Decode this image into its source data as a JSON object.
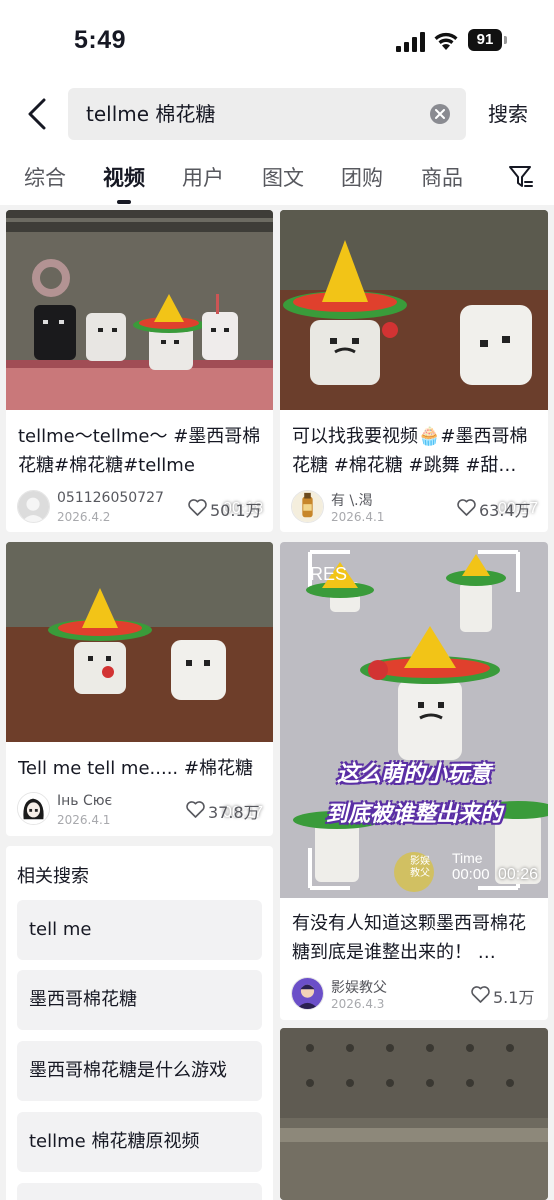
{
  "status_bar": {
    "time": "5:49",
    "battery": "91"
  },
  "search": {
    "query": "tellme 棉花糖",
    "button_label": "搜索"
  },
  "tabs": [
    {
      "label": "综合",
      "active": false
    },
    {
      "label": "视频",
      "active": true
    },
    {
      "label": "用户",
      "active": false
    },
    {
      "label": "图文",
      "active": false
    },
    {
      "label": "团购",
      "active": false
    },
    {
      "label": "商品",
      "active": false
    }
  ],
  "videos": [
    {
      "title": "tellme～tellme～ #墨西哥棉花糖#棉花糖#tellme",
      "duration": "00:18",
      "author": "051126050727",
      "date": "2026.4.2",
      "likes": "50.1万"
    },
    {
      "title": "可以找我要视频🧁#墨西哥棉花糖 #棉花糖 #跳舞 #甜…",
      "duration": "00:17",
      "author": "有 \\.渴",
      "date": "2026.4.1",
      "likes": "63.4万"
    },
    {
      "title": "Tell me tell me..... #棉花糖",
      "duration": "00:17",
      "author": "Інь Сює",
      "date": "2026.4.1",
      "likes": "37.8万"
    },
    {
      "title": "有没有人知道这颗墨西哥棉花糖到底是谁整出来的！ …",
      "duration": "00:26",
      "author": "影娱教父",
      "date": "2026.4.3",
      "likes": "5.1万",
      "overlay_line1": "这么萌的小玩意",
      "overlay_line2": "到底被谁整出来的",
      "overlay_res": "RES",
      "overlay_time": "Time",
      "overlay_timecode": "00:00",
      "overlay_watermark": "影娱 教父"
    }
  ],
  "related": {
    "title": "相关搜索",
    "items": [
      "tell me",
      "墨西哥棉花糖",
      "墨西哥棉花糖是什么游戏",
      "tellme 棉花糖原视频"
    ]
  },
  "colors": {
    "page_bg": "#f2f2f2",
    "text_primary": "#161823",
    "text_secondary": "#57585e",
    "sombrero_yellow": "#f2c417",
    "sombrero_red": "#e0402d",
    "sombrero_green": "#3a9b3a"
  }
}
